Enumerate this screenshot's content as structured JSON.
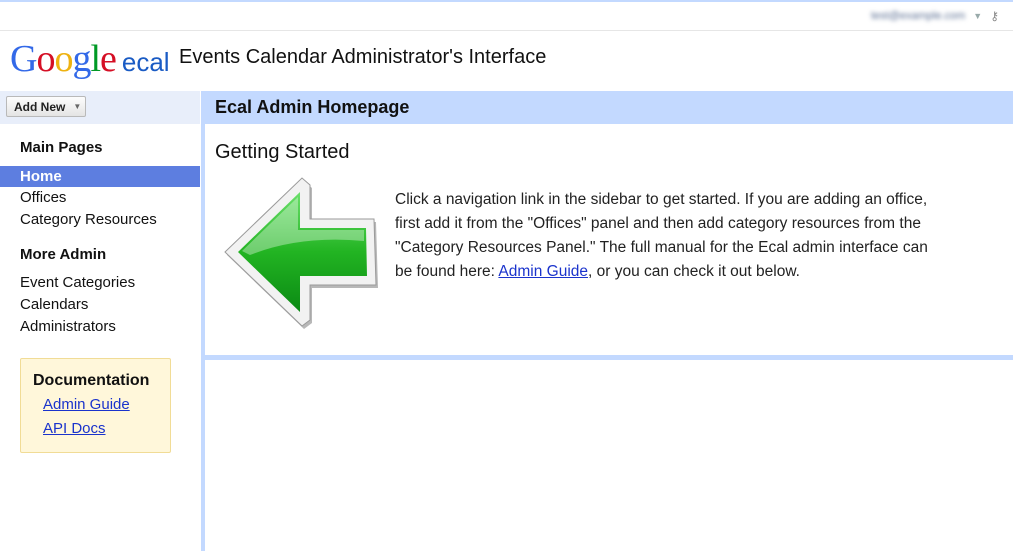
{
  "header": {
    "user_email": "test@example.com",
    "logo": {
      "google": "Google",
      "product": "ecal"
    },
    "app_title": "Events Calendar Administrator's Interface"
  },
  "sidebar": {
    "add_new_label": "Add New",
    "main_pages_heading": "Main Pages",
    "main_pages": [
      {
        "label": "Home",
        "selected": true
      },
      {
        "label": "Offices",
        "selected": false
      },
      {
        "label": "Category Resources",
        "selected": false
      }
    ],
    "more_admin_heading": "More Admin",
    "more_admin": [
      {
        "label": "Event Categories"
      },
      {
        "label": "Calendars"
      },
      {
        "label": "Administrators"
      }
    ],
    "documentation": {
      "heading": "Documentation",
      "links": [
        {
          "label": "Admin Guide"
        },
        {
          "label": "API Docs"
        }
      ]
    }
  },
  "main": {
    "header": "Ecal Admin Homepage",
    "panel_title": "Getting Started",
    "arrow_icon": "green-left-arrow-icon",
    "intro_before_link": "Click a navigation link in the sidebar to get started. If you are adding an office, first add it from the \"Offices\" panel and then add category resources from the \"Category Resources Panel.\" The full manual for the Ecal admin interface can be found here: ",
    "intro_link": "Admin Guide",
    "intro_after_link": ", or you can check it out below."
  },
  "colors": {
    "accent": "#c3d9ff",
    "nav_selected": "#5d7ee0",
    "doc_box": "#fff7da",
    "link": "#1a33cc",
    "arrow_green": "#22b422"
  }
}
